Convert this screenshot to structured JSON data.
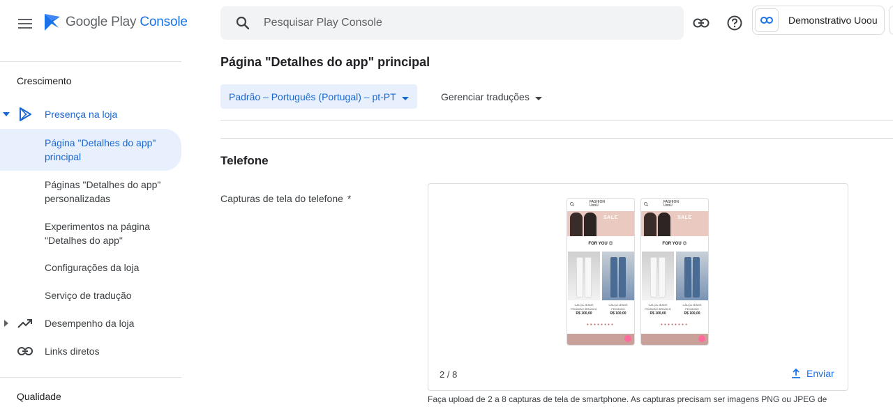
{
  "brand": {
    "name_part1": "Google Play ",
    "name_part2": "Console"
  },
  "search": {
    "placeholder": "Pesquisar Play Console"
  },
  "account": {
    "name": "Demonstrativo Uoou"
  },
  "sidebar": {
    "sections": [
      {
        "title": "Crescimento"
      },
      {
        "title": "Qualidade"
      }
    ],
    "items": [
      {
        "label": "Presença na loja"
      },
      {
        "label": "Página \"Detalhes do app\" principal"
      },
      {
        "label": "Páginas \"Detalhes do app\" personalizadas"
      },
      {
        "label": "Experimentos na página \"Detalhes do app\""
      },
      {
        "label": "Configurações da loja"
      },
      {
        "label": "Serviço de tradução"
      },
      {
        "label": "Desempenho da loja"
      },
      {
        "label": "Links diretos"
      }
    ]
  },
  "main": {
    "title": "Página \"Detalhes do app\" principal",
    "language_button": "Padrão – Português (Portugal) – pt-PT",
    "manage_translations": "Gerenciar traduções",
    "section_title": "Telefone",
    "field_label": "Capturas de tela do telefone",
    "required_mark": "*",
    "counter": "2 / 8",
    "send_label": "Enviar",
    "help_text": "Faça upload de 2 a 8 capturas de tela de smartphone. As capturas precisam ser imagens PNG ou JPEG de"
  },
  "thumbnails": [
    {
      "brand": "FASHION\nUooU",
      "banner": "SALE",
      "for_you": "FOR YOU 😍",
      "captions": [
        "CALÇA JEANS FEMININO BRANCO",
        "CALÇA JEANS FEMININO"
      ],
      "prices": [
        "R$ 100,00",
        "R$ 100,00"
      ]
    },
    {
      "brand": "FASHION\nUooU",
      "banner": "SALE",
      "for_you": "FOR YOU 😍",
      "captions": [
        "CALÇA JEANS FEMININO BRANCO",
        "CALÇA JEANS FEMININO"
      ],
      "prices": [
        "R$ 100,00",
        "R$ 100,00"
      ]
    }
  ],
  "colors": {
    "accent": "#1a73e8",
    "active_bg": "#e8f0fe",
    "active_text": "#1967d2"
  }
}
